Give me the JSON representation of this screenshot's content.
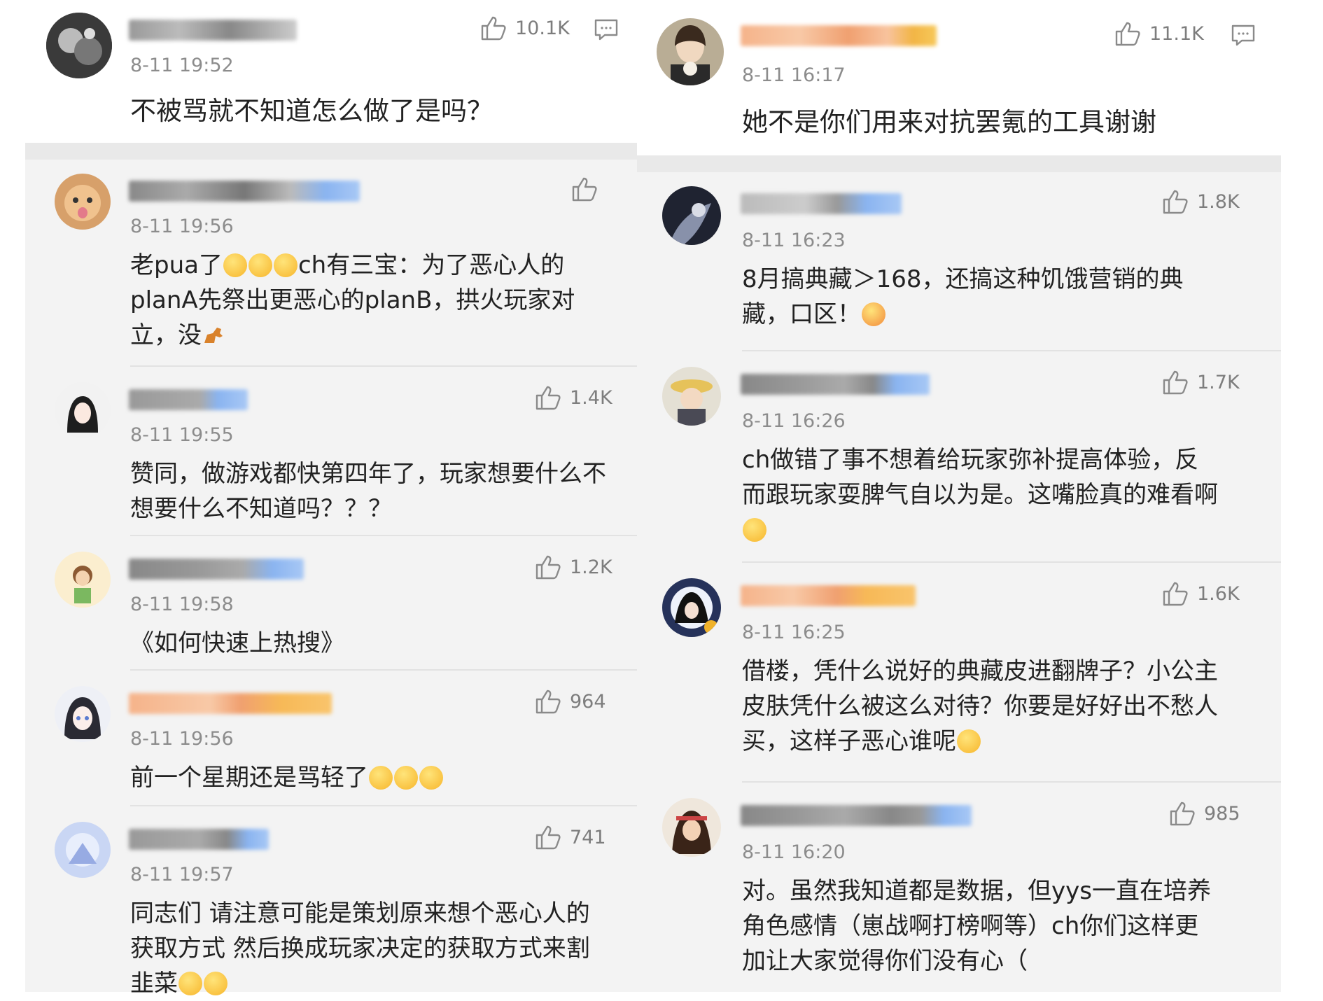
{
  "left": {
    "main_comment": {
      "time": "8-11 19:52",
      "likes": "10.1K",
      "text": "不被骂就不知道怎么做了是吗？"
    },
    "replies": [
      {
        "time": "8-11 19:56",
        "likes": "",
        "lines": [
          "老pua了",
          "ch有三宝：为了恶心人的",
          "planA先祭出更恶心的planB，拱火玩家对",
          "立，没"
        ]
      },
      {
        "name_prefix": "-l",
        "time": "8-11 19:55",
        "likes": "1.4K",
        "lines": [
          "赞同，做游戏都快第四年了，玩家想要什么不",
          "想要什么不知道吗？？？"
        ]
      },
      {
        "time": "8-11 19:58",
        "likes": "1.2K",
        "lines": [
          "《如何快速上热搜》"
        ]
      },
      {
        "time": "8-11 19:56",
        "likes": "964",
        "lines": [
          "前一个星期还是骂轻了"
        ]
      },
      {
        "time": "8-11 19:57",
        "likes": "741",
        "lines": [
          "同志们 请注意可能是策划原来想个恶心人的",
          "获取方式 然后换成玩家决定的获取方式来割",
          "韭菜"
        ]
      }
    ]
  },
  "right": {
    "main_comment": {
      "time": "8-11 16:17",
      "likes": "11.1K",
      "text": "她不是你们用来对抗罢氪的工具谢谢"
    },
    "replies": [
      {
        "name_prefix": "I",
        "time": "8-11 16:23",
        "likes": "1.8K",
        "lines": [
          "8月搞典藏＞168，还搞这种饥饿营销的典",
          "藏，口区！"
        ]
      },
      {
        "time": "8-11 16:26",
        "likes": "1.7K",
        "lines": [
          "ch做错了事不想着给玩家弥补提高体验，反",
          "而跟玩家耍脾气自以为是。这嘴脸真的难看啊",
          ""
        ]
      },
      {
        "time": "8-11 16:25",
        "likes": "1.6K",
        "lines": [
          "借楼，凭什么说好的典藏皮进翻牌子？小公主",
          "皮肤凭什么被这么对待？你要是好好出不愁人",
          "买，这样子恶心谁呢"
        ]
      },
      {
        "time": "8-11 16:20",
        "likes": "985",
        "lines": [
          "对。虽然我知道都是数据，但yys一直在培养",
          "角色感情（崽战啊打榜啊等）ch你们这样更",
          "加让大家觉得你们没有心（"
        ]
      }
    ]
  },
  "icons": {
    "like": "thumbs-up-icon",
    "comment": "comment-icon"
  },
  "colors": {
    "background": "#ffffff",
    "reply_bg": "#f3f3f3",
    "separator": "#e9e9e9",
    "muted": "#8c8c8c"
  }
}
